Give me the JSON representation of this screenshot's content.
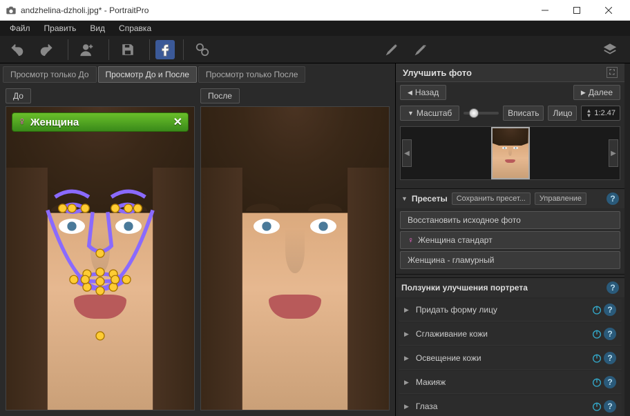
{
  "window": {
    "title": "andzhelina-dzholi.jpg* - PortraitPro"
  },
  "menu": {
    "file": "Файл",
    "edit": "Править",
    "view": "Вид",
    "help": "Справка"
  },
  "viewtabs": {
    "before_only": "Просмотр только До",
    "both": "Просмотр До и После",
    "after_only": "Просмотр только После"
  },
  "labels": {
    "before": "До",
    "after": "После"
  },
  "gender": {
    "label": "Женщина"
  },
  "panel": {
    "title": "Улучшить фото",
    "back": "Назад",
    "next": "Далее",
    "scale": "Масштаб",
    "fit": "Вписать",
    "face": "Лицо",
    "zoom_ratio": "1:2.47"
  },
  "presets": {
    "title": "Пресеты",
    "save": "Сохранить пресет...",
    "manage": "Управление",
    "restore": "Восстановить исходное фото",
    "female_standard": "Женщина стандарт",
    "female_glamour": "Женщина - гламурный"
  },
  "sliders_section": {
    "title": "Ползунки улучшения портрета",
    "items": [
      "Придать форму лицу",
      "Сглаживание кожи",
      "Освещение кожи",
      "Макияж",
      "Глаза"
    ]
  }
}
